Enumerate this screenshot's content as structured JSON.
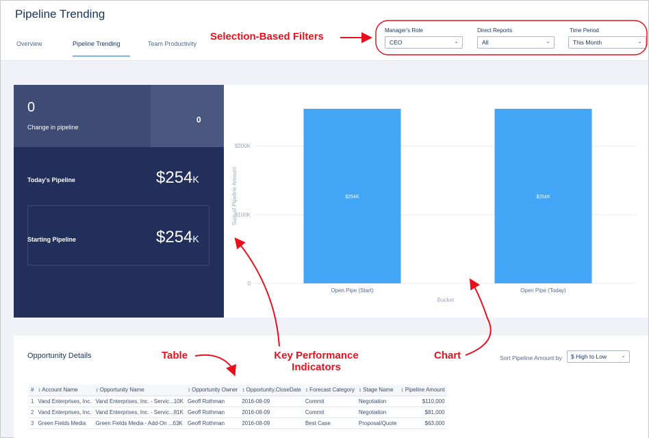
{
  "page": {
    "title": "Pipeline Trending"
  },
  "tabs": [
    {
      "label": "Overview"
    },
    {
      "label": "Pipeline Trending"
    },
    {
      "label": "Team Productivity"
    }
  ],
  "filters": {
    "role": {
      "label": "Manager's Role",
      "value": "CEO"
    },
    "reports": {
      "label": "Direct Reports",
      "value": "All"
    },
    "period": {
      "label": "Time Period",
      "value": "This Month"
    }
  },
  "kpis": {
    "change_value": "0",
    "change_label": "Change in pipeline",
    "change_secondary": "0",
    "today_label": "Today's Pipeline",
    "today_value": "$254",
    "today_suffix": "K",
    "starting_label": "Starting Pipeline",
    "starting_value": "$254",
    "starting_suffix": "K"
  },
  "chart_data": {
    "type": "bar",
    "categories": [
      "Open Pipe (Start)",
      "Open Pipe (Today)"
    ],
    "values": [
      254,
      254
    ],
    "value_labels": [
      "$254K",
      "$254K"
    ],
    "xlabel": "Bucket",
    "ylabel": "Sum of Pipeline Amount",
    "yticks": [
      {
        "value": 0,
        "label": "0"
      },
      {
        "value": 100,
        "label": "$100K"
      },
      {
        "value": 200,
        "label": "$200K"
      }
    ],
    "ylim": [
      0,
      254
    ],
    "grid": true,
    "bar_color": "#42a5f5"
  },
  "table": {
    "title": "Opportunity Details",
    "sort_label": "Sort Pipeline Amount by",
    "sort_value": "$ High to Low",
    "columns": [
      "#",
      "↕ Account Name",
      "↕ Opportunity Name",
      "↕ Opportunity Owner",
      "↕ Opportunity.CloseDate",
      "↕ Forecast Category",
      "↕ Stage Name",
      "↕ Pipeline Amount"
    ],
    "rows": [
      [
        "1",
        "Vand Enterprises, Inc.",
        "Vand Enterprises, Inc. - Servic...10K",
        "Geoff Rothman",
        "2016-08-09",
        "Commit",
        "Negotiation",
        "$110,000"
      ],
      [
        "2",
        "Vand Enterprises, Inc.",
        "Vand Enterprises, Inc. - Servic...81K",
        "Geoff Rothman",
        "2016-08-09",
        "Commit",
        "Negotiation",
        "$81,000"
      ],
      [
        "3",
        "Green Fields Media",
        "Green Fields Media - Add-On ...63K",
        "Geoff Rothman",
        "2016-08-09",
        "Best Case",
        "Proposal/Quote",
        "$63,000"
      ]
    ]
  },
  "annotations": {
    "filters": "Selection-Based Filters",
    "table": "Table",
    "kpi_line1": "Key Performance",
    "kpi_line2": "Indicators",
    "chart": "Chart"
  },
  "colors": {
    "annotation": "#e8101d",
    "kpi_dark": "#222f5b",
    "kpi_mid": "#3e4c74",
    "bar": "#42a5f5"
  }
}
